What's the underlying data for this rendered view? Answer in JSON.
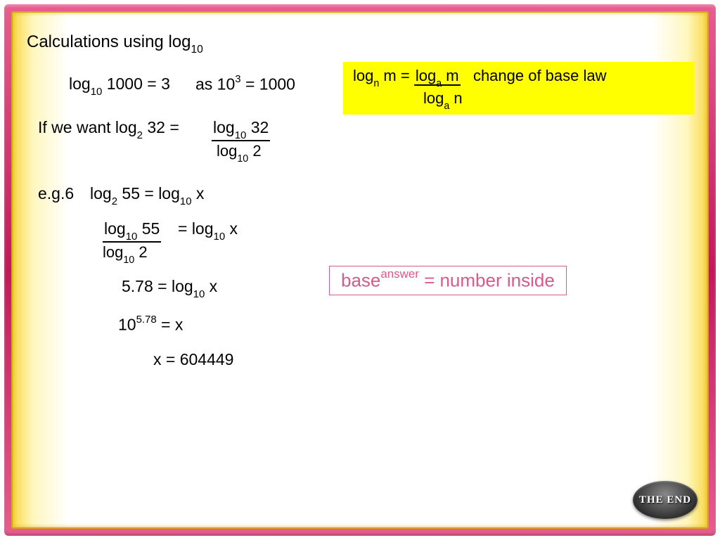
{
  "title_prefix": "Calculations using log",
  "title_sub": "10",
  "law": {
    "lhs_log": "log",
    "lhs_sub": "n",
    "lhs_arg": " m = ",
    "num_log": "log",
    "num_sub": "a",
    "num_arg": " m",
    "den_log": "log",
    "den_sub": "a",
    "den_arg": " n",
    "label": "change of base law"
  },
  "ex1": {
    "lhs": "log",
    "lhs_sub": "10",
    "lhs_rest": " 1000 = 3",
    "rhs_pre": "as 10",
    "rhs_sup": "3",
    "rhs_post": " = 1000"
  },
  "ex2": {
    "pre": "If we want log",
    "pre_sub": "2",
    "pre_post": " 32 = ",
    "num": "log",
    "num_sub": "10",
    "num_post": " 32",
    "den": "log",
    "den_sub": "10",
    "den_post": " 2"
  },
  "eg": {
    "label": "e.g.6",
    "lhs": "log",
    "lhs_sub": "2",
    "lhs_post": " 55 = log",
    "rhs_sub": "10",
    "rhs_post": " x",
    "f_num": "log",
    "f_num_sub": "10",
    "f_num_post": " 55",
    "f_den": "log",
    "f_den_sub": "10",
    "f_den_post": " 2",
    "f_eq": " = log",
    "f_eq_sub": "10",
    "f_eq_post": " x",
    "s2_l": "5.78  = log",
    "s2_sub": "10",
    "s2_post": " x",
    "s3_pre": "10",
    "s3_sup": "5.78",
    "s3_post": " = x",
    "s4": "x = 604449"
  },
  "hint": {
    "base": "base",
    "sup": "answer",
    "rest": " = number inside"
  },
  "end_label": "THE END"
}
